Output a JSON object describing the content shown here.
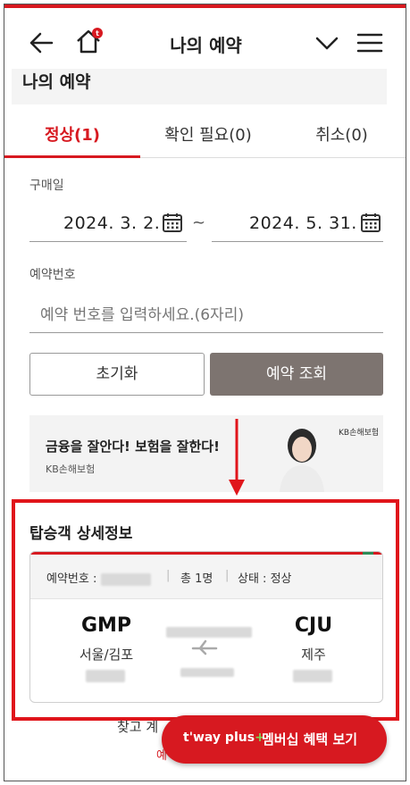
{
  "header": {
    "title": "나의 예약"
  },
  "section": {
    "title": "나의 예약"
  },
  "tabs": [
    {
      "label": "정상(1)"
    },
    {
      "label": "확인 필요(0)"
    },
    {
      "label": "취소(0)"
    }
  ],
  "purchase_date": {
    "label": "구매일",
    "start": "2024. 3. 2.",
    "end": "2024. 5. 31.",
    "separator": "~"
  },
  "reservation_number": {
    "label": "예약번호",
    "placeholder": "예약 번호를 입력하세요.(6자리)"
  },
  "buttons": {
    "reset": "초기화",
    "search": "예약 조회"
  },
  "ad": {
    "title": "금융을 잘안다! 보험을 잘한다!",
    "sponsor": "KB손해보험",
    "logo_text": "KB손해보험"
  },
  "passenger_detail": {
    "title": "탑승객 상세정보",
    "reservation_label": "예약번호 :",
    "total_label": "총 1명",
    "status_label": "상태 : 정상",
    "departure": {
      "code": "GMP",
      "city": "서울/김포"
    },
    "arrival": {
      "code": "CJU",
      "city": "제주"
    }
  },
  "footer": {
    "partial_text": "찾고 계",
    "partial_link": "예"
  },
  "fab": {
    "brand": "t'way plus",
    "brand_plus": "+",
    "label": "멤버십 혜택 보기"
  },
  "colors": {
    "brand_red": "#d71920",
    "search_button": "#7d7470",
    "highlight_red": "#e0151b"
  }
}
